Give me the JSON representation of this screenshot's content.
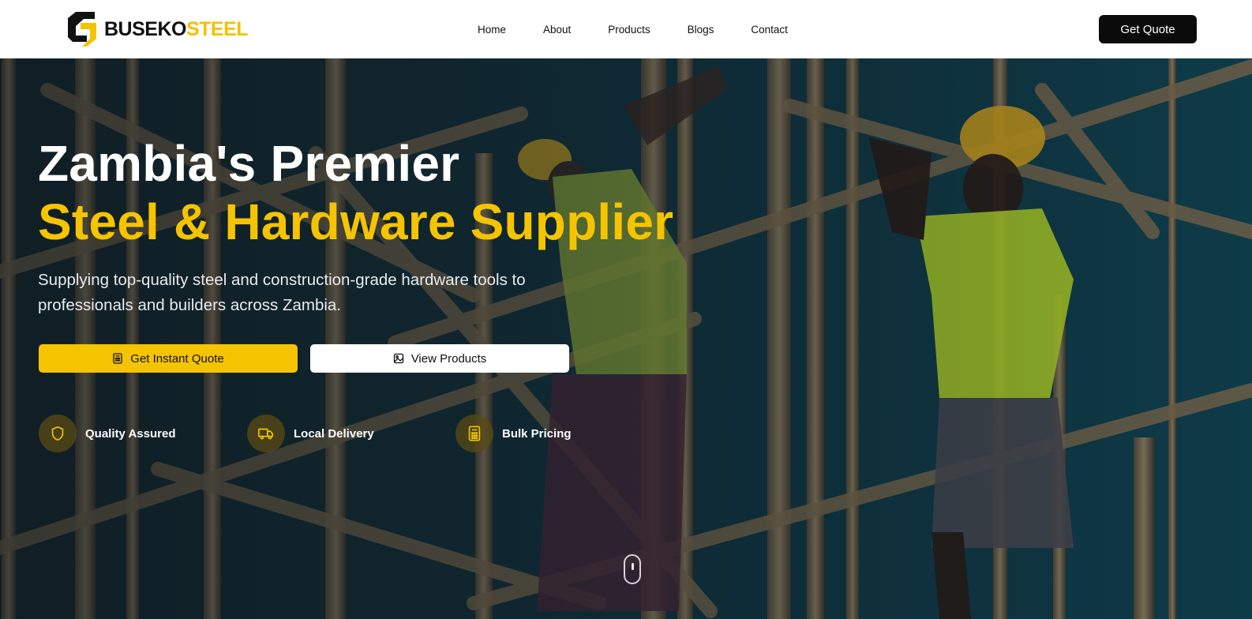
{
  "brand": {
    "name_part1": "BUSEKO",
    "name_part2": "STEEL",
    "accent": "#f5c400"
  },
  "nav": {
    "links": [
      "Home",
      "About",
      "Products",
      "Blogs",
      "Contact"
    ],
    "cta_label": "Get Quote"
  },
  "hero": {
    "title_line1": "Zambia's Premier",
    "title_line2": "Steel & Hardware Supplier",
    "subtitle": "Supplying top-quality steel and construction-grade hardware tools to professionals and builders across Zambia.",
    "primary_button": {
      "label": "Get Instant Quote",
      "icon": "calculator-icon"
    },
    "secondary_button": {
      "label": "View Products",
      "icon": "image-icon"
    },
    "features": [
      {
        "label": "Quality Assured",
        "icon": "shield-icon"
      },
      {
        "label": "Local Delivery",
        "icon": "truck-icon"
      },
      {
        "label": "Bulk Pricing",
        "icon": "calculator-icon"
      }
    ],
    "background": "construction workers on bamboo scaffolding"
  }
}
